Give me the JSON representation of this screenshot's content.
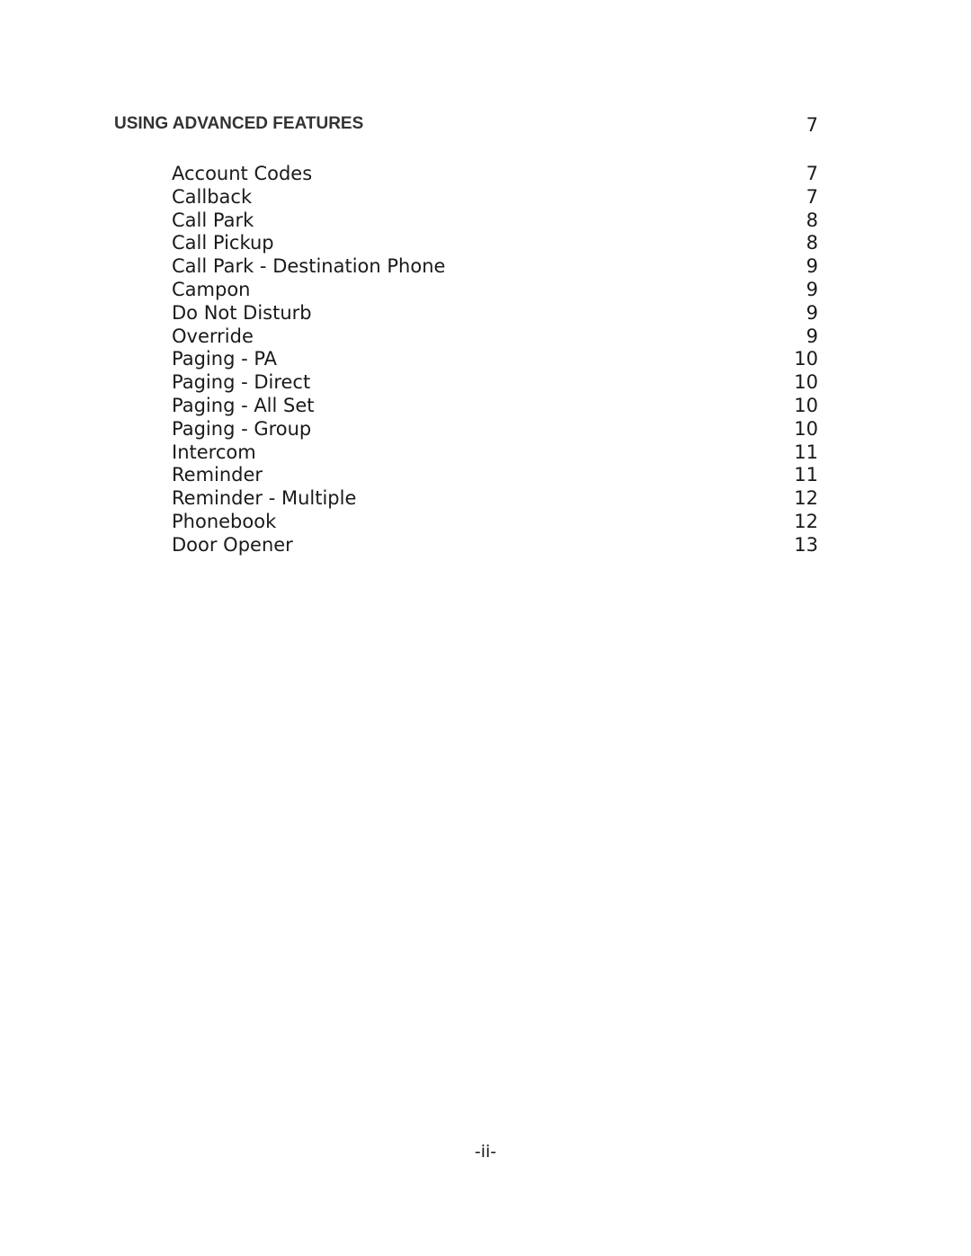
{
  "section": {
    "title": "USING ADVANCED FEATURES",
    "page": "7"
  },
  "entries": [
    {
      "label": "Account Codes",
      "page": "7"
    },
    {
      "label": "Callback",
      "page": "7"
    },
    {
      "label": "Call Park",
      "page": "8"
    },
    {
      "label": "Call Pickup",
      "page": "8"
    },
    {
      "label": "Call Park - Destination Phone",
      "page": "9"
    },
    {
      "label": "Campon",
      "page": "9"
    },
    {
      "label": "Do Not Disturb",
      "page": "9"
    },
    {
      "label": "Override",
      "page": "9"
    },
    {
      "label": "Paging - PA",
      "page": "10"
    },
    {
      "label": "Paging - Direct",
      "page": "10"
    },
    {
      "label": "Paging - All Set",
      "page": "10"
    },
    {
      "label": "Paging - Group",
      "page": "10"
    },
    {
      "label": "Intercom",
      "page": "11"
    },
    {
      "label": "Reminder",
      "page": "11"
    },
    {
      "label": "Reminder - Multiple",
      "page": "12"
    },
    {
      "label": "Phonebook",
      "page": "12"
    },
    {
      "label": "Door Opener",
      "page": "13"
    }
  ],
  "footer": {
    "page_number": "-ii-"
  }
}
